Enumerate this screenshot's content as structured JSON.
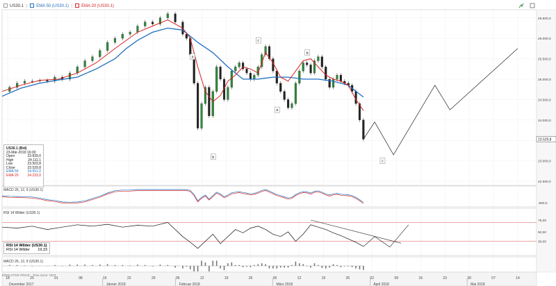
{
  "header": {
    "price_symbol": "US30.1",
    "ema50_label": "EMA 50 (US30.1)",
    "ema20_label": "EMA 20 (US30.1)"
  },
  "info_box": {
    "title": "US30.1 (Bid)",
    "datetime": "23-Mär-2018 16:00",
    "rows": [
      {
        "k": "Open",
        "v": "23.839,0"
      },
      {
        "k": "High",
        "v": "24.111,1"
      },
      {
        "k": "Low",
        "v": "23.503,8"
      },
      {
        "k": "Close",
        "v": "23.529,8"
      },
      {
        "k": "EMA 50",
        "v": "24.551,0"
      },
      {
        "k": "EMA 20",
        "v": "24.233,0"
      }
    ]
  },
  "price_badge": "23.529,8",
  "rsi_box": {
    "title": "RSI 14 Wilder (US30.1)",
    "label": "RSI 14 Wilder",
    "value": "19,33"
  },
  "panel_labels": {
    "macd1": "MACD 26, 12, 9 (US30.1)",
    "rsi": "RSI 14 Wilder (US30.1)",
    "macd2": "MACD 26, 12, 9 (US30.1)"
  },
  "footer": "INDICATIVE PRICE · Time Zone: GMT",
  "colors": {
    "ema50": "#1f6fbf",
    "ema20": "#d62222",
    "up": "#2e8b3a",
    "down": "#222222"
  },
  "icons": [
    "chart-type-icon",
    "tool-icon",
    "settings-icon"
  ],
  "chart_data": {
    "type": "line",
    "title": "",
    "price_axis": {
      "ticks": [
        "26.500,0",
        "26.000,0",
        "25.500,0",
        "25.000,0",
        "24.500,0",
        "24.000,0",
        "23.500,0",
        "23.000,0",
        "22.500,0"
      ],
      "ylim": [
        22400,
        26700
      ]
    },
    "date_axis": {
      "ticks": [
        "18",
        "25",
        "01",
        "08",
        "15",
        "22",
        "29",
        "05",
        "12",
        "19",
        "26",
        "05",
        "12",
        "19",
        "26",
        "02",
        "09",
        "16",
        "23",
        "30",
        "07",
        "14"
      ],
      "months": [
        "Dezember 2017",
        "Jänner 2018",
        "Februar 2018",
        "März 2018",
        "April 2018",
        "Mai 2018"
      ]
    },
    "wave_labels": [
      "a",
      "b",
      "c",
      "a",
      "b",
      "c"
    ],
    "series": [
      {
        "name": "EMA 50 (US30.1)",
        "color": "#1f6fbf",
        "x": [
          0,
          5,
          10,
          15,
          20,
          25,
          30,
          33,
          36,
          40,
          44,
          48,
          52,
          56,
          60,
          64,
          68,
          72,
          76,
          80,
          84,
          88,
          92,
          96
        ],
        "y": [
          24580,
          24780,
          24900,
          24980,
          25050,
          25250,
          25500,
          25750,
          25950,
          26150,
          26250,
          26200,
          25900,
          25650,
          25300,
          25000,
          25000,
          25050,
          25050,
          25000,
          25000,
          24950,
          24850,
          24560
        ]
      },
      {
        "name": "EMA 20 (US30.1)",
        "color": "#d62222",
        "x": [
          0,
          5,
          10,
          15,
          20,
          25,
          30,
          33,
          36,
          40,
          44,
          48,
          50,
          52,
          54,
          56,
          58,
          60,
          62,
          64,
          66,
          68,
          70,
          72,
          74,
          76,
          78,
          80,
          82,
          84,
          86,
          88,
          90,
          92,
          94,
          96
        ],
        "y": [
          24700,
          24850,
          24970,
          25000,
          25150,
          25400,
          25750,
          25950,
          26150,
          26300,
          26450,
          26250,
          26000,
          25300,
          24700,
          24450,
          24600,
          24950,
          25100,
          25300,
          25250,
          25150,
          25650,
          25400,
          25050,
          24950,
          25200,
          25450,
          25500,
          25300,
          25100,
          25000,
          24950,
          24850,
          24500,
          24230
        ]
      },
      {
        "name": "Price",
        "color": "#222222",
        "x": [
          0,
          2,
          4,
          6,
          8,
          10,
          12,
          14,
          16,
          18,
          20,
          22,
          24,
          26,
          28,
          30,
          32,
          34,
          36,
          38,
          40,
          42,
          44,
          46,
          48,
          49,
          50,
          51,
          52,
          53,
          54,
          55,
          56,
          57,
          58,
          59,
          60,
          61,
          62,
          63,
          64,
          65,
          66,
          67,
          68,
          69,
          70,
          71,
          72,
          73,
          74,
          75,
          76,
          77,
          78,
          79,
          80,
          81,
          82,
          83,
          84,
          85,
          86,
          87,
          88,
          89,
          90,
          91,
          92,
          93,
          94,
          95,
          96
        ],
        "y": [
          24700,
          24800,
          24900,
          24950,
          24950,
          24970,
          24950,
          25050,
          25000,
          25150,
          25300,
          25450,
          25550,
          25700,
          25900,
          26000,
          26100,
          26150,
          26300,
          26400,
          26350,
          26500,
          26600,
          26400,
          26100,
          26000,
          25600,
          24900,
          23800,
          24400,
          24800,
          24100,
          24700,
          25300,
          25000,
          24500,
          24800,
          25200,
          25300,
          25400,
          25250,
          25150,
          25000,
          25100,
          25300,
          25600,
          25800,
          25500,
          25200,
          24900,
          24700,
          24500,
          24300,
          24400,
          24900,
          25200,
          25400,
          25350,
          25150,
          25450,
          25550,
          25300,
          25000,
          24800,
          25000,
          25100,
          24950,
          24900,
          24850,
          24700,
          24400,
          24000,
          23530
        ]
      },
      {
        "name": "Projection",
        "color": "#222222",
        "x": [
          96,
          99,
          104,
          115,
          119,
          137
        ],
        "y": [
          23530,
          23950,
          23150,
          24850,
          24250,
          25750
        ]
      }
    ],
    "rsi": {
      "ticks": [
        "75,00",
        "50,00",
        "30,00"
      ],
      "ylim": [
        0,
        100
      ],
      "levels": [
        70,
        30
      ],
      "x": [
        0,
        4,
        8,
        12,
        16,
        20,
        24,
        28,
        32,
        36,
        40,
        44,
        48,
        50,
        52,
        54,
        56,
        58,
        60,
        62,
        64,
        66,
        68,
        70,
        72,
        74,
        76,
        78,
        80,
        82,
        84,
        86,
        88,
        90,
        92,
        94,
        96
      ],
      "y": [
        60,
        58,
        62,
        55,
        60,
        65,
        62,
        66,
        60,
        64,
        62,
        70,
        40,
        28,
        15,
        30,
        45,
        25,
        40,
        55,
        48,
        58,
        62,
        55,
        45,
        40,
        50,
        30,
        45,
        65,
        60,
        55,
        48,
        42,
        35,
        28,
        19
      ]
    },
    "macd1": {
      "ticks": [
        "-500,0"
      ]
    },
    "macd2": {
      "ticks": [
        ""
      ]
    }
  }
}
